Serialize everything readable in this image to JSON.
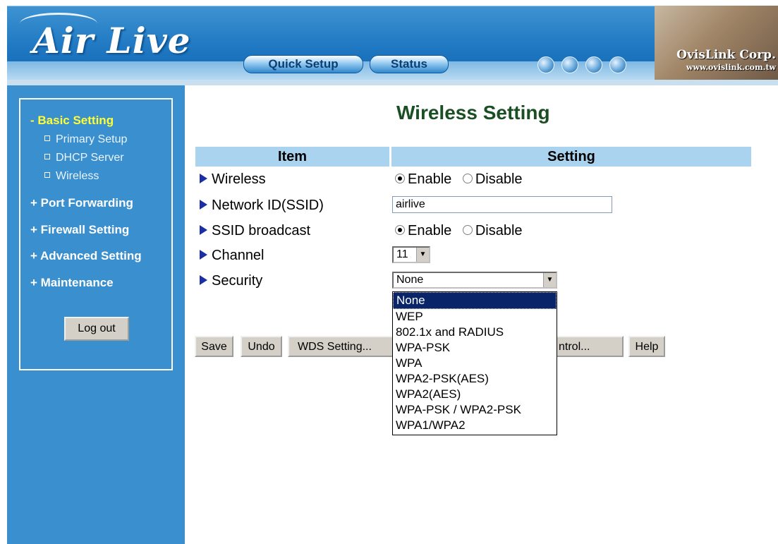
{
  "header": {
    "logo": "Air Live",
    "quick_setup": "Quick Setup",
    "status": "Status",
    "brand_name": "OvisLink Corp.",
    "brand_url": "www.ovislink.com.tw",
    "globe_icons": [
      "globe-icon",
      "globe-icon",
      "globe-icon",
      "globe-icon"
    ]
  },
  "sidebar": {
    "basic_setting": "- Basic Setting",
    "sub_items": [
      "Primary Setup",
      "DHCP Server",
      "Wireless"
    ],
    "port_forwarding": "+ Port Forwarding",
    "firewall_setting": "+ Firewall Setting",
    "advanced_setting": "+ Advanced Setting",
    "maintenance": "+ Maintenance",
    "logout": "Log out"
  },
  "main": {
    "title": "Wireless Setting",
    "table_headers": {
      "item": "Item",
      "setting": "Setting"
    },
    "rows": {
      "wireless": "Wireless",
      "ssid": "Network ID(SSID)",
      "ssid_broadcast": "SSID broadcast",
      "channel": "Channel",
      "security": "Security"
    },
    "enable_label": "Enable",
    "disable_label": "Disable",
    "ssid_value": "airlive",
    "channel_value": "11",
    "security_value": "None",
    "security_options": [
      "None",
      "WEP",
      "802.1x and RADIUS",
      "WPA-PSK",
      "WPA",
      "WPA2-PSK(AES)",
      "WPA2(AES)",
      "WPA-PSK / WPA2-PSK",
      "WPA1/WPA2"
    ],
    "buttons": {
      "save": "Save",
      "undo": "Undo",
      "wds": "WDS Setting...",
      "access_control": "ntrol...",
      "help": "Help"
    }
  },
  "colors": {
    "sidebar_bg": "#3a8fcf",
    "active_menu": "#ffff33",
    "table_header_bg": "#a9d3ee",
    "title_color": "#1a4f24",
    "selected_option": "#0a246a"
  }
}
